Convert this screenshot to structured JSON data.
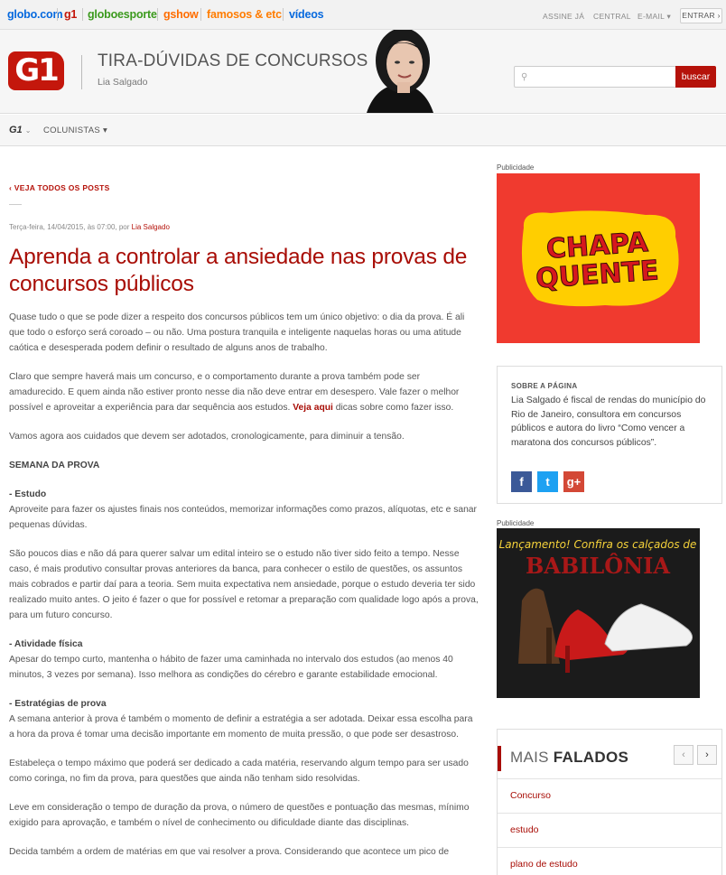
{
  "topbar": {
    "brands": [
      "globo.com",
      "g1",
      "globoesporte",
      "gshow",
      "famosos & etc",
      "vídeos"
    ],
    "links": [
      "ASSINE JÁ",
      "CENTRAL",
      "E-MAIL ▾"
    ],
    "login_button": "ENTRAR ›"
  },
  "header": {
    "logo": "G1",
    "blog_title": "TIRA-DÚVIDAS DE CONCURSOS",
    "blog_author": "Lia Salgado",
    "search_placeholder": "",
    "search_button": "buscar"
  },
  "subnav": {
    "logo": "G1",
    "colunistas": "COLUNISTAS ▾"
  },
  "article": {
    "back_link": "‹ VEJA TODOS OS POSTS",
    "meta_date": "Terça-feira, 14/04/2015, às 07:00, por ",
    "meta_author": "Lia Salgado",
    "headline": "Aprenda a controlar a ansiedade nas provas de concursos públicos",
    "p1": "Quase tudo o que se pode dizer a respeito dos concursos públicos tem um único objetivo: o dia da prova. É ali que todo o esforço será coroado – ou não. Uma postura tranquila e inteligente naquelas horas ou uma atitude caótica e desesperada podem definir o resultado de alguns anos de trabalho.",
    "p2_before": "Claro que sempre haverá mais um concurso, e o comportamento durante a prova também pode ser amadurecido. E quem ainda não estiver pronto nesse dia não deve entrar em desespero. Vale fazer o melhor possível e aproveitar a experiência para dar sequência aos estudos. ",
    "p2_link": "Veja aqui",
    "p2_after": " dicas sobre como fazer isso.",
    "p3": "Vamos agora aos cuidados que devem ser adotados, cronologicamente, para diminuir a tensão.",
    "section": "SEMANA DA PROVA",
    "estudo_title": "- Estudo",
    "estudo_text": "Aproveite para fazer os ajustes finais nos conteúdos, memorizar informações como prazos, alíquotas, etc e sanar pequenas dúvidas.",
    "p4": "São poucos dias e não dá para querer salvar um edital inteiro se o estudo não tiver sido feito a tempo. Nesse caso, é mais produtivo consultar provas anteriores da banca, para conhecer o estilo de questões, os assuntos mais cobrados e partir daí para a teoria. Sem muita expectativa nem ansiedade, porque o estudo deveria ter sido realizado muito antes. O jeito é fazer o que for possível e retomar a preparação com qualidade logo após a prova, para um futuro concurso.",
    "fisica_title": "- Atividade física",
    "fisica_text": "Apesar do tempo curto, mantenha o hábito de fazer uma caminhada no intervalo dos estudos (ao menos 40 minutos, 3 vezes por semana). Isso melhora as condições do cérebro e garante estabilidade emocional.",
    "estrat_title": "- Estratégias de prova",
    "estrat_text": "A semana anterior à prova é também o momento de definir a estratégia a ser adotada. Deixar essa escolha para a hora da prova é tomar uma decisão importante em momento de muita pressão, o que pode ser desastroso.",
    "p5": "Estabeleça o tempo máximo que poderá ser dedicado a cada matéria, reservando algum tempo para ser usado como coringa, no fim da prova, para questões que ainda não tenham sido resolvidas.",
    "p6": "Leve em consideração o tempo de duração da prova, o número de questões e pontuação das mesmas, mínimo exigido para aprovação, e também o nível de conhecimento ou dificuldade diante das disciplinas.",
    "p7": "Decida também a ordem de matérias em que vai resolver a prova. Considerando que acontece um pico de"
  },
  "sidebar": {
    "pub_label_1": "Publicidade",
    "ad1_text_1": "CHAPA",
    "ad1_text_2": "QUENTE",
    "about_label": "SOBRE A PÁGINA",
    "about_text": "Lia Salgado é fiscal de rendas do município do Rio de Janeiro, consultora em concursos públicos e autora do livro “Como vencer a maratona dos concursos públicos”.",
    "social": [
      "f",
      "t",
      "g+"
    ],
    "pub_label_2": "Publicidade",
    "ad2_heading": "Lançamento! Confira os calçados de",
    "ad2_brand": "BABILÔNIA",
    "mais_title_light": "MAIS ",
    "mais_title_bold": "FALADOS",
    "mais_items": [
      "Concurso",
      "estudo",
      "plano de estudo"
    ]
  }
}
